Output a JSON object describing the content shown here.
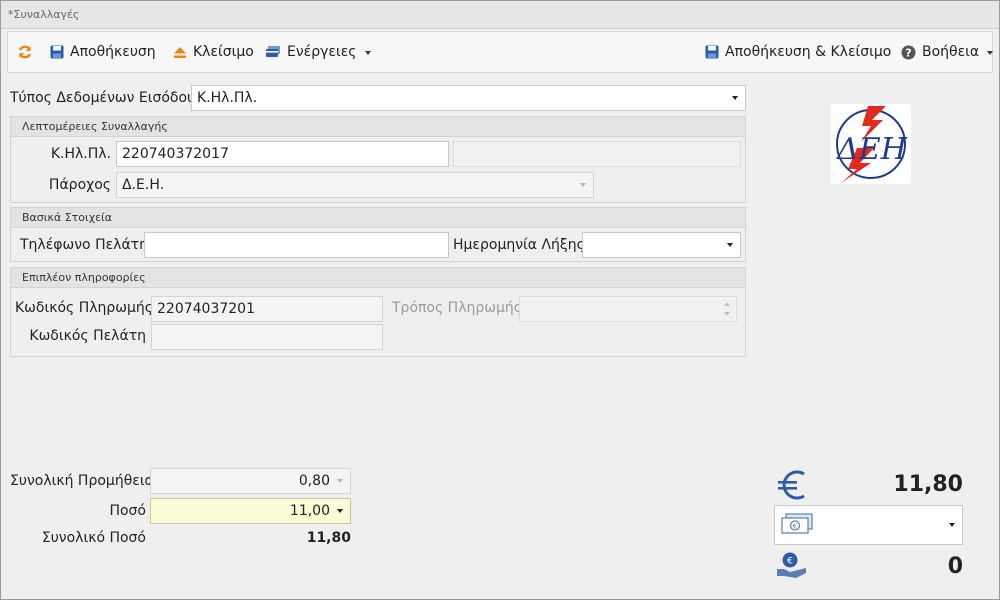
{
  "window": {
    "title": "*Συναλλαγές"
  },
  "toolbar": {
    "refresh_icon": "refresh-icon",
    "save_label": "Αποθήκευση",
    "close_label": "Κλείσιμο",
    "actions_label": "Ενέργειες",
    "save_close_label": "Αποθήκευση & Κλείσιμο",
    "help_label": "Βοήθεια"
  },
  "input_type": {
    "label": "Τύπος Δεδομένων Εισόδου",
    "value": "Κ.Ηλ.Πλ."
  },
  "details": {
    "header": "Λεπτομέρειες Συναλλαγής",
    "code_label": "Κ.Ηλ.Πλ.",
    "code_value": "220740372017",
    "code_extra": "",
    "provider_label": "Πάροχος",
    "provider_value": "Δ.Ε.Η."
  },
  "basic": {
    "header": "Βασικά Στοιχεία",
    "phone_label": "Τηλέφωνο Πελάτη",
    "phone_value": "",
    "expiry_label": "Ημερομηνία Λήξης",
    "expiry_value": ""
  },
  "extra": {
    "header": "Επιπλέον πληροφορίες",
    "payment_code_label": "Κωδικός Πληρωμής",
    "payment_code_value": "22074037201",
    "payment_method_label": "Τρόπος Πληρωμής",
    "payment_method_value": "",
    "customer_code_label": "Κωδικός Πελάτη",
    "customer_code_value": ""
  },
  "logo": {
    "text": "ΔΕΗ",
    "icon": "dei-logo"
  },
  "totals": {
    "commission_label": "Συνολική Προμήθεια",
    "commission_value": "0,80",
    "amount_label": "Ποσό",
    "amount_value": "11,00",
    "total_label": "Συνολικό Ποσό",
    "total_value": "11,80"
  },
  "summary": {
    "euro_icon": "euro-icon",
    "euro_amount": "11,80",
    "cash_icon": "banknote-icon",
    "cash_value": "",
    "change_icon": "coin-hand-icon",
    "change_amount": "0"
  },
  "colors": {
    "accent_orange": "#e8861a",
    "accent_blue": "#2a5ca8",
    "amount_highlight": "#fbfbd5"
  }
}
